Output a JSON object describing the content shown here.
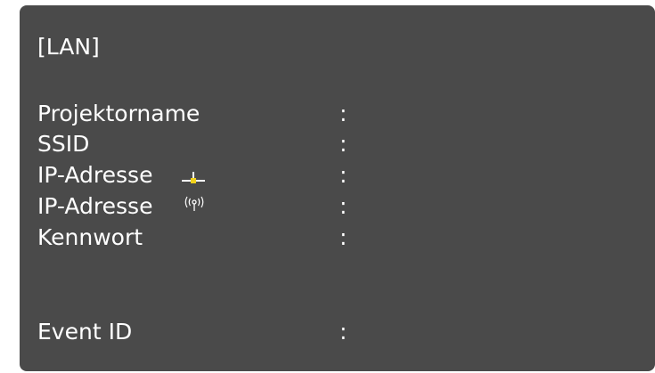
{
  "panel": {
    "title": "[LAN]",
    "rows": [
      {
        "label": "Projektorname",
        "separator": ":",
        "icon": null
      },
      {
        "label": "SSID",
        "separator": ":",
        "icon": null
      },
      {
        "label": "IP-Adresse",
        "separator": ":",
        "icon": "wired-lan-icon"
      },
      {
        "label": "IP-Adresse",
        "separator": ":",
        "icon": "wireless-lan-icon"
      },
      {
        "label": "Kennwort",
        "separator": ":",
        "icon": null
      },
      {
        "label": "Event ID",
        "separator": ":",
        "icon": null
      }
    ]
  },
  "colors": {
    "panel_background": "#4a4a4a",
    "text": "#ffffff",
    "wired_icon_accent": "#f2d21b"
  }
}
